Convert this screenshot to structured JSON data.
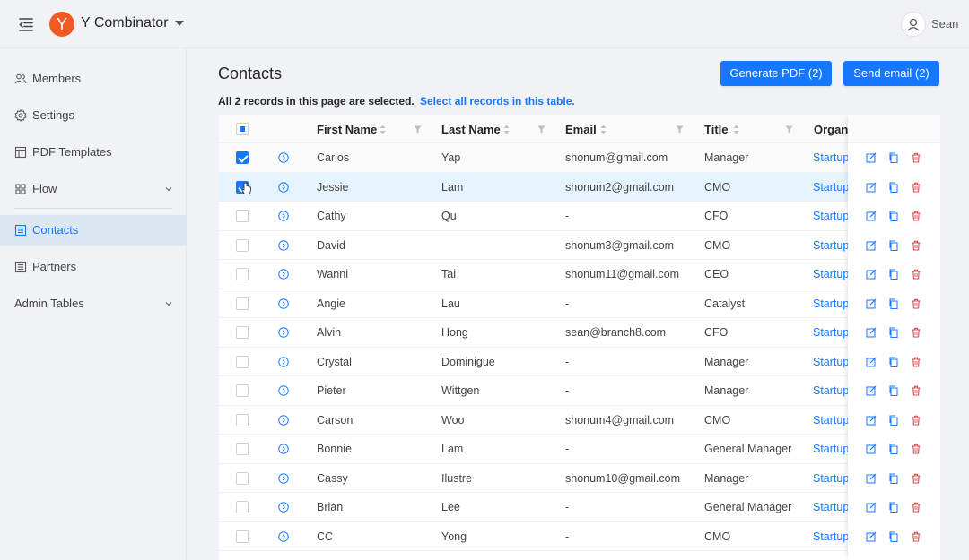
{
  "header": {
    "company": "Y Combinator",
    "logo_letter": "Y",
    "user": "Sean"
  },
  "sidebar": {
    "items": [
      {
        "label": "Members",
        "icon": "users-icon"
      },
      {
        "label": "Settings",
        "icon": "gear-icon"
      },
      {
        "label": "PDF Templates",
        "icon": "template-icon"
      },
      {
        "label": "Flow",
        "icon": "grid-icon"
      },
      {
        "label": "Contacts",
        "icon": "list-icon"
      },
      {
        "label": "Partners",
        "icon": "list-icon"
      },
      {
        "label": "Admin Tables",
        "icon": ""
      }
    ]
  },
  "main": {
    "title": "Contacts",
    "generate_pdf": "Generate PDF (2)",
    "send_email": "Send email (2)",
    "selection_info": "All 2 records in this page are selected.",
    "select_all": "Select all records in this table."
  },
  "table": {
    "columns": [
      "First Name",
      "Last Name",
      "Email",
      "Title",
      "Organi"
    ],
    "rows": [
      {
        "first": "Carlos",
        "last": "Yap",
        "email": "shonum@gmail.com",
        "title": "Manager",
        "org": "Startup"
      },
      {
        "first": "Jessie",
        "last": "Lam",
        "email": "shonum2@gmail.com",
        "title": "CMO",
        "org": "Startup"
      },
      {
        "first": "Cathy",
        "last": "Qu",
        "email": "-",
        "title": "CFO",
        "org": "Startup"
      },
      {
        "first": "David",
        "last": "",
        "email": "shonum3@gmail.com",
        "title": "CMO",
        "org": "Startup"
      },
      {
        "first": "Wanni",
        "last": "Tai",
        "email": "shonum11@gmail.com",
        "title": "CEO",
        "org": "Startup"
      },
      {
        "first": "Angie",
        "last": "Lau",
        "email": "-",
        "title": "Catalyst",
        "org": "Startup"
      },
      {
        "first": "Alvin",
        "last": "Hong",
        "email": "sean@branch8.com",
        "title": "CFO",
        "org": "Startup"
      },
      {
        "first": "Crystal",
        "last": "Dominigue",
        "email": "-",
        "title": "Manager",
        "org": "Startup"
      },
      {
        "first": "Pieter",
        "last": "Wittgen",
        "email": "-",
        "title": "Manager",
        "org": "Startup"
      },
      {
        "first": "Carson",
        "last": "Woo",
        "email": "shonum4@gmail.com",
        "title": "CMO",
        "org": "Startup"
      },
      {
        "first": "Bonnie",
        "last": "Lam",
        "email": "-",
        "title": "General Manager",
        "org": "Startup"
      },
      {
        "first": "Cassy",
        "last": "Ilustre",
        "email": "shonum10@gmail.com",
        "title": "Manager",
        "org": "Startup"
      },
      {
        "first": "Brian",
        "last": "Lee",
        "email": "-",
        "title": "General Manager",
        "org": "Startup"
      },
      {
        "first": "CC",
        "last": "Yong",
        "email": "-",
        "title": "CMO",
        "org": "Startup"
      }
    ]
  },
  "colors": {
    "primary": "#1677ff",
    "delete": "#e5484d",
    "logo": "#f15a22"
  }
}
